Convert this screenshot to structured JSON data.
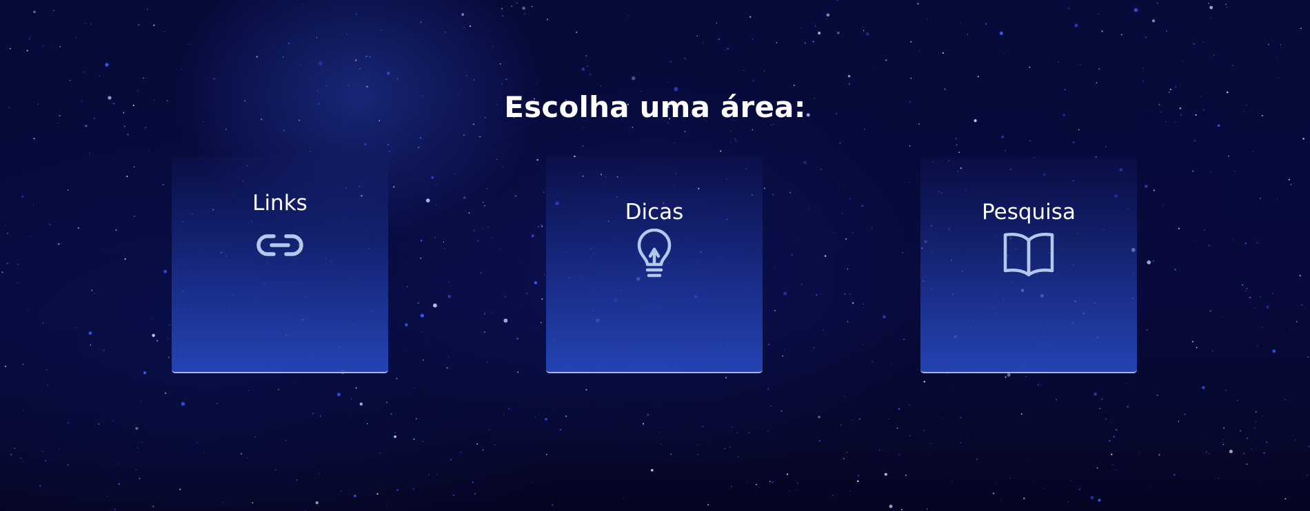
{
  "page": {
    "heading": "Escolha uma área:"
  },
  "cards": [
    {
      "label": "Links",
      "icon": "link-icon"
    },
    {
      "label": "Dicas",
      "icon": "lightbulb-icon"
    },
    {
      "label": "Pesquisa",
      "icon": "book-icon"
    }
  ],
  "colors": {
    "background": "#070a3a",
    "card_gradient_top": "#161e6e",
    "card_gradient_bottom": "#2648be",
    "card_border": "#9fb7ef",
    "icon_stroke": "#b4c8ee",
    "text": "#ffffff"
  }
}
